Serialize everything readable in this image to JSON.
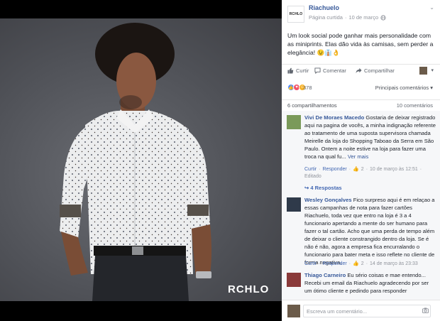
{
  "post": {
    "page_name": "Riachuelo",
    "page_logo_text": "RCHLO",
    "meta_label": "Página curtida",
    "separator": "·",
    "date": "10 de março",
    "text": "Um look social pode ganhar mais personalidade com as miniprints. Elas dão vida às camisas, sem perder a elegância! 😉👔👌",
    "photo_watermark": "RCHLO"
  },
  "actions": {
    "like": "Curtir",
    "comment": "Comentar",
    "share": "Compartilhar"
  },
  "reactions": {
    "count": "378",
    "sort_label": "Principais comentários ▾",
    "shares": "6 compartilhamentos",
    "comments": "10 comentários"
  },
  "comments": [
    {
      "name": "Vivi De Moraes Macedo",
      "text": "Gostaria de deixar registrado aqui na pagina de vocês, a minha indignação referente ao tratamento de uma suposta supervisora chamada Meirelle da loja do Shopping Taboao da Serra em São Paulo. Ontem a noite estive na loja para fazer uma troca na qual fu...",
      "more": "Ver mais",
      "like": "Curtir",
      "reply": "Responder",
      "likes": "2",
      "time": "10 de março às 12:51",
      "edited": "Editado",
      "replies": "4 Respostas",
      "avatar_color": "#7a9a5a"
    },
    {
      "name": "Wesley Gonçalves",
      "text": "Fico surpreso aqui é em relaçao a essas campanhas de nota para fazer cartões Riachuelo, toda vez que entro na loja é 3 a 4 funcionario apertando a mente do ser humano para fazer o tal cartão. Acho que uma perda de tempo além de deixar o cliente constrangido dentro da loja. Se é não é não, agora a empresa fica encurralando o funcionario para bater meta e isso reflete no cliente de forma negativa.",
      "like": "Curtir",
      "reply": "Responder",
      "likes": "2",
      "time": "14 de março às 23:33",
      "avatar_color": "#2f3a4a"
    },
    {
      "name": "Thiago Carneiro",
      "text": "Eu sério coisas e mae entendo... Recebi um email da Riachuelo agradecendo por ser um ótimo cliente e pedindo para responder",
      "avatar_color": "#8a3a3a"
    }
  ],
  "composer": {
    "placeholder": "Escreva um comentário..."
  }
}
